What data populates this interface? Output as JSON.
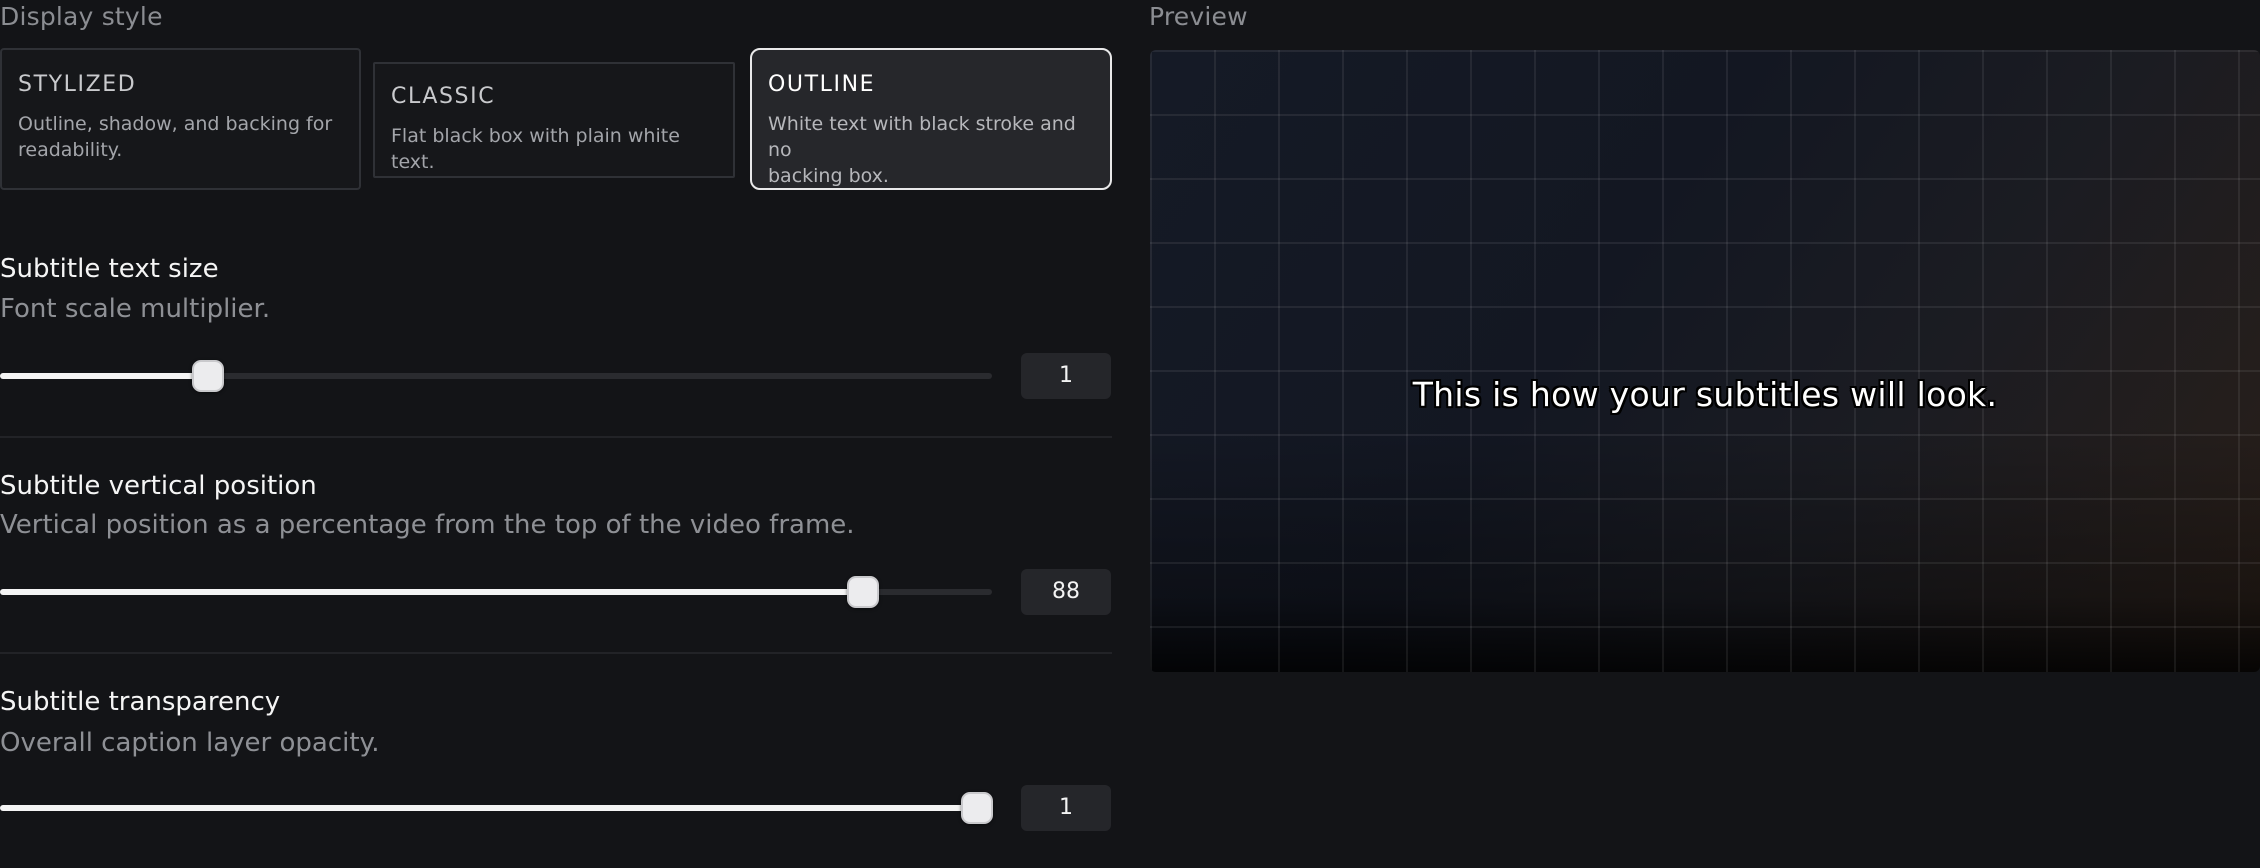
{
  "display_style": {
    "label": "Display style",
    "options": [
      {
        "title": "STYLIZED",
        "desc_line1": "Outline, shadow, and backing for",
        "desc_line2": "readability.",
        "selected": false
      },
      {
        "title": "CLASSIC",
        "desc_line1": "Flat black box with plain white text.",
        "desc_line2": "",
        "selected": false
      },
      {
        "title": "OUTLINE",
        "desc_line1": "White text with black stroke and no",
        "desc_line2": "backing box.",
        "selected": true
      }
    ]
  },
  "settings": {
    "text_size": {
      "title": "Subtitle text size",
      "desc": "Font scale multiplier.",
      "value": "1",
      "fraction": 0.21
    },
    "vertical_position": {
      "title": "Subtitle vertical position",
      "desc": "Vertical position as a percentage from the top of the video frame.",
      "value": "88",
      "fraction": 0.87
    },
    "transparency": {
      "title": "Subtitle transparency",
      "desc": "Overall caption layer opacity.",
      "value": "1",
      "fraction": 0.985
    }
  },
  "preview": {
    "label": "Preview",
    "subtitle_text": "This is how your subtitles will look."
  },
  "colors": {
    "background": "#131417",
    "card_selected_bg": "#26272b",
    "slider_fill": "#f4f4f4",
    "slider_track": "#2a2b2f",
    "value_box_bg": "#25262a"
  }
}
